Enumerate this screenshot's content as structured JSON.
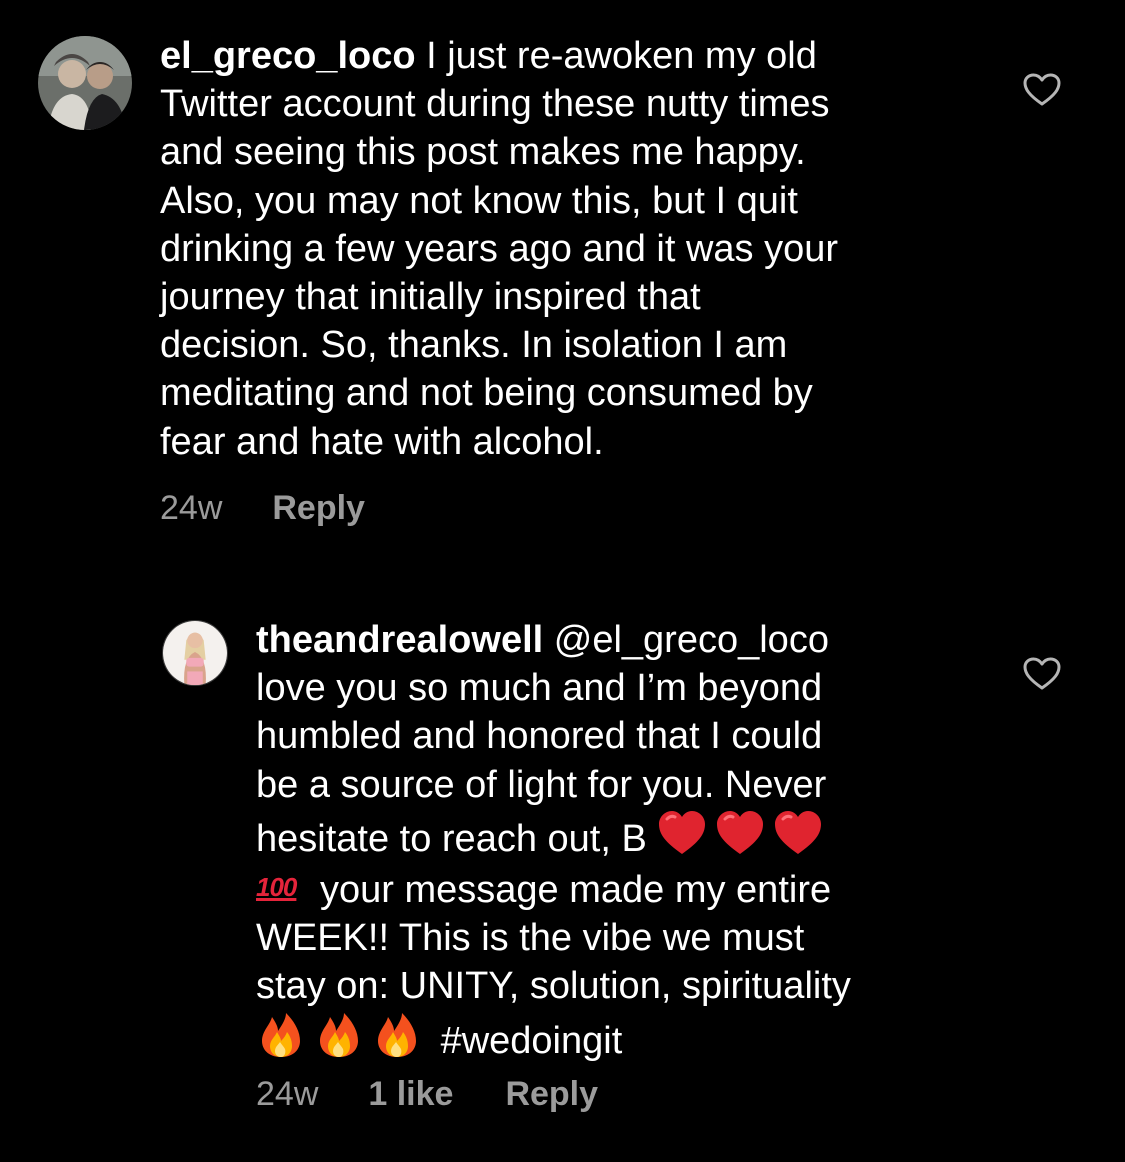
{
  "comments": [
    {
      "username": "el_greco_loco",
      "text": "I just re-awoken my old\nTwitter account during these nutty times\nand seeing this post makes me happy.\nAlso, you may not know this, but I quit\ndrinking a few years ago and it was your\njourney that initially inspired that\ndecision. So, thanks. In isolation I am\nmeditating and not being consumed by\nfear and hate with alcohol.",
      "age": "24w",
      "reply_label": "Reply",
      "like_icon": "heart-outline-icon"
    },
    {
      "username": "theandrealowell",
      "mention": "@el_greco_loco",
      "text_part1": "love you so much and I’m beyond\nhumbled and honored that I could\nbe a source of light for you. Never\nhesitate to reach out, B",
      "hundred_emoji": "100",
      "text_part2": "your message made my entire\nWEEK!! This is the vibe we must\nstay on: UNITY, solution, spirituality\n",
      "hashtag": "#wedoingit",
      "age": "24w",
      "likes": "1 like",
      "reply_label": "Reply",
      "like_icon": "heart-outline-icon",
      "emojis": [
        "red-heart-icon",
        "red-heart-icon",
        "red-heart-icon",
        "hundred-points-icon",
        "fire-icon",
        "fire-icon",
        "fire-icon"
      ]
    }
  ],
  "colors": {
    "background": "#000000",
    "text": "#ffffff",
    "meta": "#9b9b9b",
    "heart_emoji": "#e0242f",
    "hundred_emoji": "#e5243b"
  }
}
